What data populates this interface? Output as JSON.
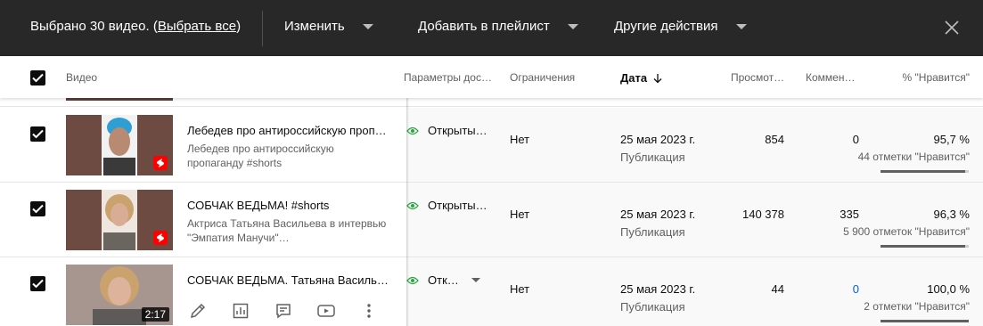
{
  "topbar": {
    "selected_prefix": "Выбрано 30 видео. (",
    "select_all": "Выбрать все",
    "selected_suffix": ")",
    "edit_label": "Изменить",
    "add_playlist_label": "Добавить в плейлист",
    "other_actions_label": "Другие действия",
    "colors": {
      "bg": "#282828",
      "text": "#ffffff"
    }
  },
  "header": {
    "video": "Видео",
    "visibility": "Параметры дос…",
    "restrictions": "Ограничения",
    "date": "Дата",
    "views": "Просмот…",
    "comments": "Коммен…",
    "likes": "% \"Нравится\""
  },
  "rows": [
    {
      "title": "Лебедев про антироссийскую проп…",
      "description": "Лебедев про антироссийскую пропаганду #shorts",
      "visibility": "Открыты…",
      "restriction": "Нет",
      "date": "25 мая 2023 г.",
      "date_status": "Публикация",
      "views": "854",
      "comments": "0",
      "likes_pct": "95,7 %",
      "likes_count": "44 отметки \"Нравится\"",
      "like_ratio": 0.957,
      "thumb": {
        "bg": "#6d4a42",
        "face": "#3aa7d8",
        "badge": "shorts"
      }
    },
    {
      "title": "СОБЧАК ВЕДЬМА! #shorts",
      "description": "Актриса Татьяна Васильева в интервью \"Эмпатия Манучи\"…",
      "visibility": "Открыты…",
      "restriction": "Нет",
      "date": "25 мая 2023 г.",
      "date_status": "Публикация",
      "views": "140 378",
      "comments": "335",
      "likes_pct": "96,3 %",
      "likes_count": "5 900 отметок \"Нравится\"",
      "like_ratio": 0.963,
      "thumb": {
        "bg": "#6d4a42",
        "face": "#c9a26e",
        "badge": "shorts"
      }
    },
    {
      "title": "СОБЧАК ВЕДЬМА. Татьяна Василье…",
      "visibility": "Отк…",
      "restriction": "Нет",
      "date": "25 мая 2023 г.",
      "date_status": "Публикация",
      "views": "44",
      "comments": "0",
      "likes_pct": "100,0 %",
      "likes_count": "2 отметки \"Нравится\"",
      "like_ratio": 1.0,
      "duration": "2:17",
      "thumb": {
        "bg": "#8a7c78",
        "face": "#c9a26e",
        "badge": "duration"
      },
      "actions": [
        "edit-icon",
        "analytics-icon",
        "comments-icon",
        "youtube-icon",
        "more-vert-icon"
      ]
    }
  ],
  "colors": {
    "accent": "#065fd4",
    "shorts": "#ff0000",
    "row_bg": "#f9f9f9"
  }
}
